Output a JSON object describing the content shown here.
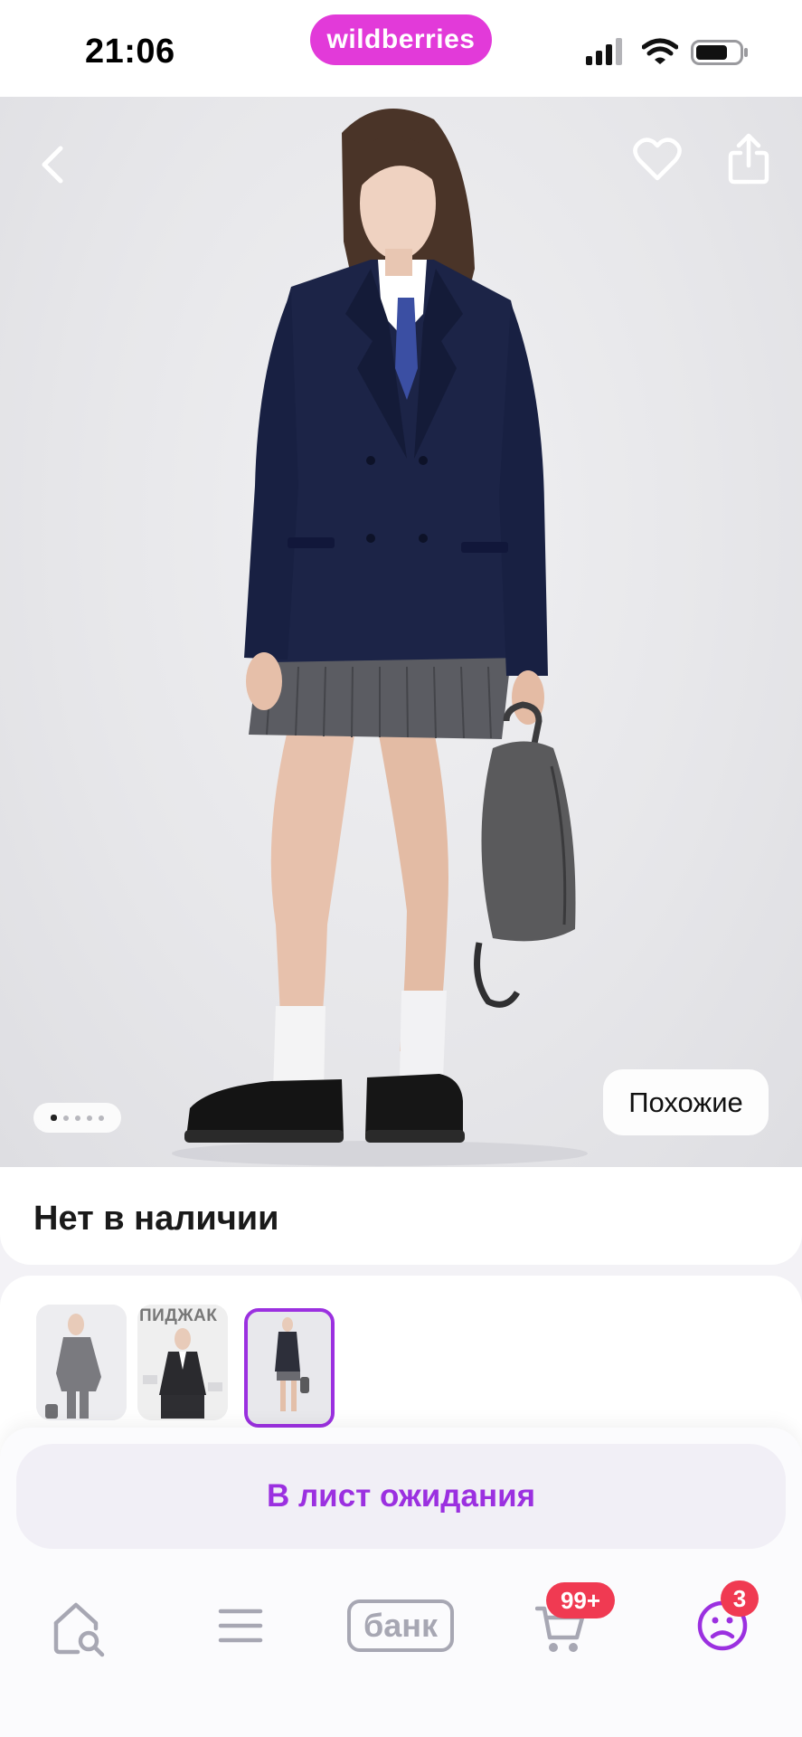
{
  "status_bar": {
    "time": "21:06",
    "brand": "wildberries",
    "signal_icon": "cellular-signal-icon",
    "wifi_icon": "wifi-icon",
    "battery_icon": "battery-icon"
  },
  "product": {
    "back_icon": "chevron-left-icon",
    "favorite_icon": "heart-icon",
    "share_icon": "share-icon",
    "gallery": {
      "count": 5,
      "active_index": 0
    },
    "similar_label": "Похожие",
    "availability": "Нет в наличии",
    "thumbnails": [
      {
        "label": ""
      },
      {
        "label": "ПИДЖАК"
      },
      {
        "label": "",
        "selected": true
      }
    ]
  },
  "actions": {
    "waitlist_label": "В лист ожидания"
  },
  "tabbar": {
    "home_icon": "home-search-icon",
    "catalog_icon": "menu-icon",
    "bank_label": "банк",
    "cart_icon": "cart-icon",
    "cart_badge": "99+",
    "profile_icon": "profile-icon",
    "profile_badge": "3"
  },
  "colors": {
    "brand": "#e23ad9",
    "accent": "#9b30e0",
    "badge": "#f03a52",
    "inactive_icon": "#a7a7b3"
  }
}
